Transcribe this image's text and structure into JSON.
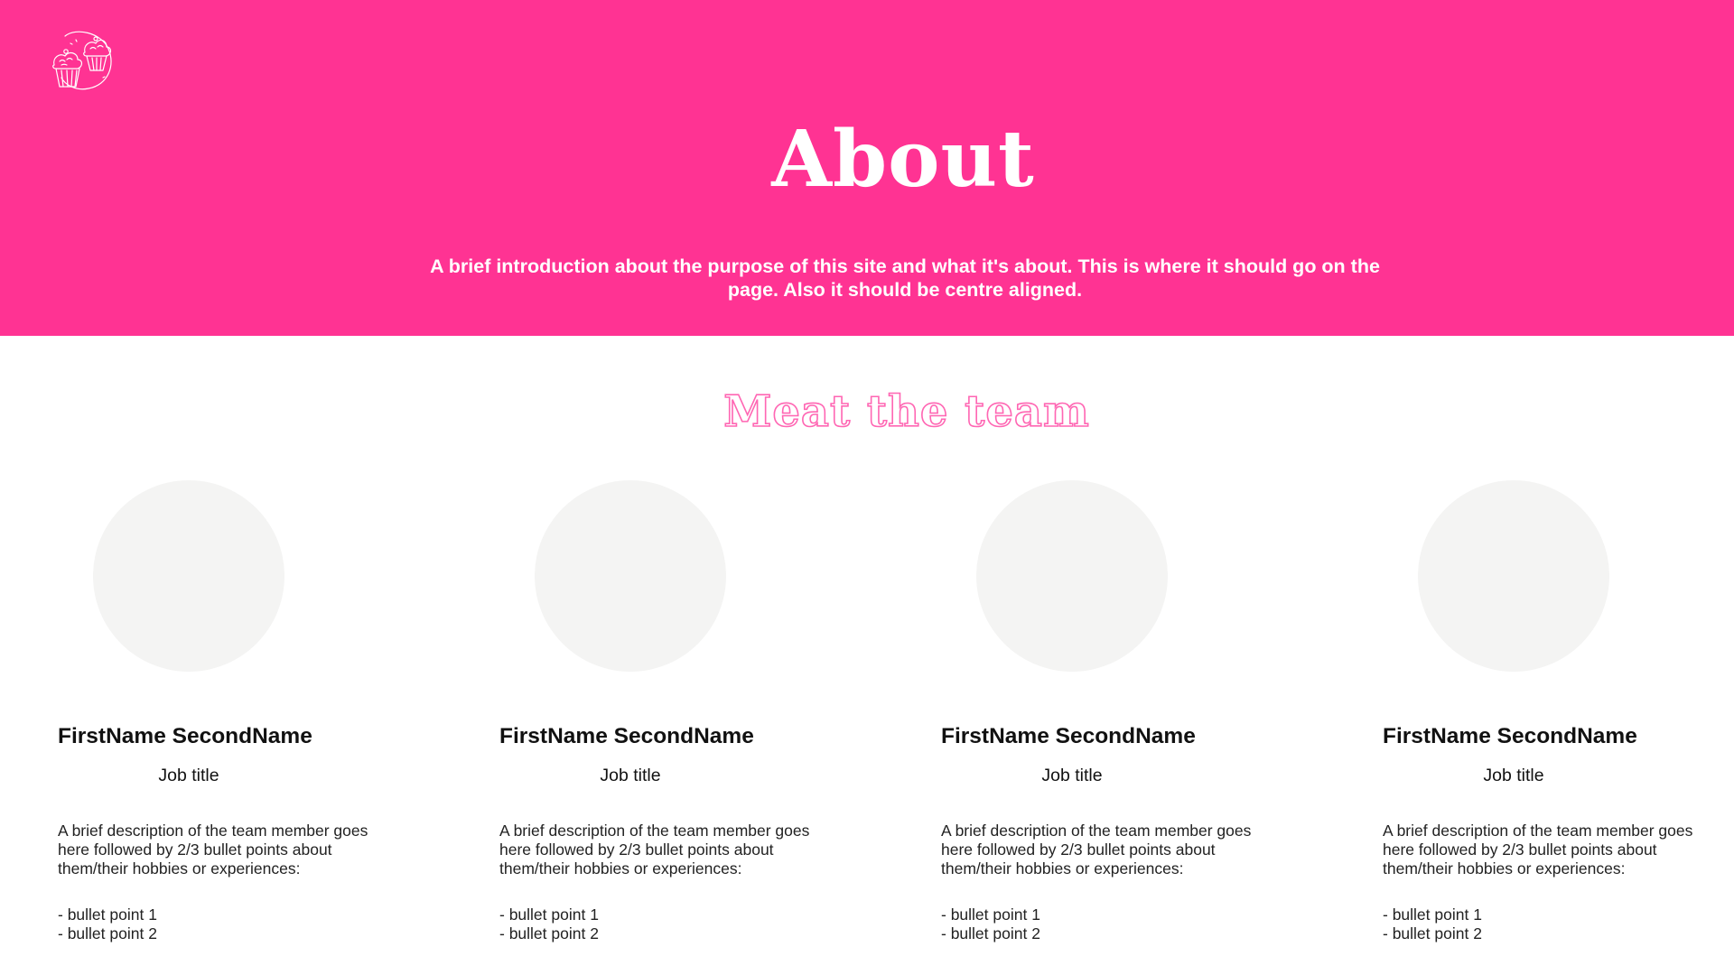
{
  "colors": {
    "hero_background": "#ff3393",
    "hero_text": "#ffffff",
    "heading_outline": "#ff66b3",
    "avatar_placeholder": "#f4f4f3"
  },
  "header": {
    "logo_icon": "cupcakes-logo-icon",
    "title": "About",
    "intro": "A brief introduction about the purpose of this site and what it's about. This is where it should go on the page. Also it should be centre aligned."
  },
  "team": {
    "heading": "Meat the team",
    "members": [
      {
        "name": "FirstName SecondName",
        "job_title": "Job title",
        "description": "A brief description of the team member goes here followed by 2/3 bullet points about them/their hobbies or experiences:",
        "bullets": [
          "- bullet point 1",
          "- bullet point 2"
        ]
      },
      {
        "name": "FirstName SecondName",
        "job_title": "Job title",
        "description": "A brief description of the team member goes here followed by 2/3 bullet points about them/their hobbies or experiences:",
        "bullets": [
          "- bullet point 1",
          "- bullet point 2"
        ]
      },
      {
        "name": "FirstName SecondName",
        "job_title": "Job title",
        "description": "A brief description of the team member goes here followed by 2/3 bullet points about them/their hobbies or experiences:",
        "bullets": [
          "- bullet point 1",
          "- bullet point 2"
        ]
      },
      {
        "name": "FirstName SecondName",
        "job_title": "Job title",
        "description": "A brief description of the team member goes here followed by 2/3 bullet points about them/their hobbies or experiences:",
        "bullets": [
          "- bullet point 1",
          "- bullet point 2"
        ]
      }
    ]
  }
}
